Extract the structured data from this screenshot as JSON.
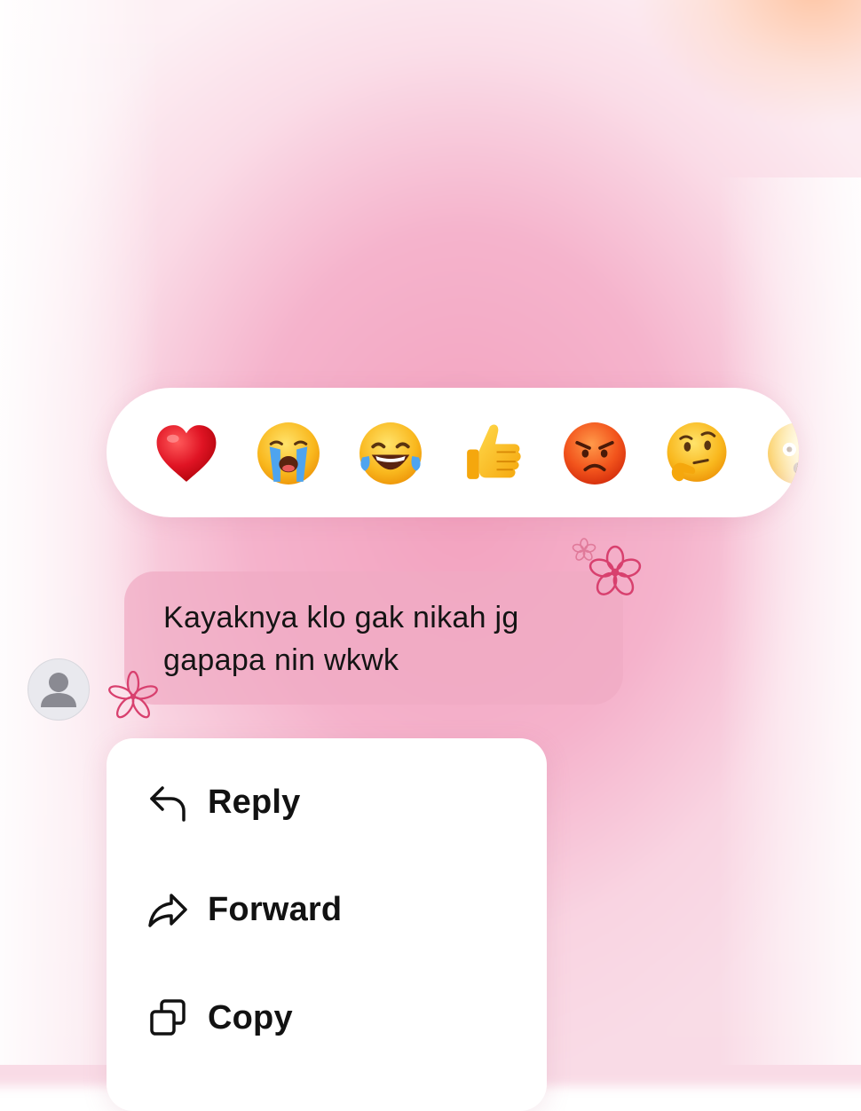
{
  "reactions": [
    {
      "icon": "red-heart-icon"
    },
    {
      "icon": "loudly-crying-face-icon"
    },
    {
      "icon": "face-with-tears-of-joy-icon"
    },
    {
      "icon": "thumbs-up-icon"
    },
    {
      "icon": "angry-face-icon"
    },
    {
      "icon": "thinking-face-icon"
    },
    {
      "icon": "astonished-face-icon"
    }
  ],
  "message": {
    "text_line1": "Kayaknya klo gak nikah jg",
    "text_line2": "gapapa nin wkwk",
    "avatar_icon": "default-user-avatar-icon"
  },
  "menu": {
    "items": [
      {
        "label": "Reply",
        "icon": "reply-arrow-icon"
      },
      {
        "label": "Forward",
        "icon": "forward-arrow-icon"
      },
      {
        "label": "Copy",
        "icon": "copy-icon"
      }
    ]
  },
  "colors": {
    "bubble": "#f0aac4",
    "background_pink": "#f29ebc",
    "menu_bg": "#ffffff",
    "flower": "#d8406e"
  }
}
